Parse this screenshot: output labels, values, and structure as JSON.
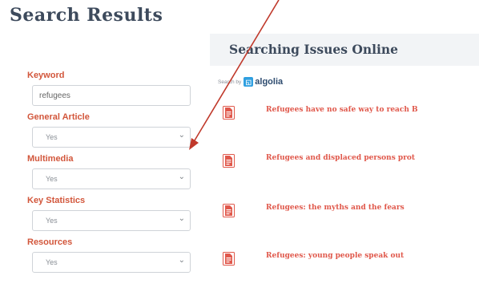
{
  "page": {
    "title": "Search Results"
  },
  "filters": {
    "keyword": {
      "label": "Keyword",
      "value": "refugees"
    },
    "selects": [
      {
        "label": "General Article",
        "value": "Yes"
      },
      {
        "label": "Multimedia",
        "value": "Yes"
      },
      {
        "label": "Key Statistics",
        "value": "Yes"
      },
      {
        "label": "Resources",
        "value": "Yes"
      }
    ]
  },
  "results": {
    "title": "Searching Issues Online",
    "search_by": "Search by",
    "provider": "algolia",
    "items": [
      {
        "title": "Refugees have no safe way to reach B"
      },
      {
        "title": "Refugees and displaced persons prot"
      },
      {
        "title": "Refugees: the myths and the fears"
      },
      {
        "title": "Refugees: young people speak out"
      }
    ]
  },
  "colors": {
    "label": "#d2563b",
    "result_title": "#e0584b",
    "heading": "#3d4a5c",
    "algolia": "#2f9fe0",
    "arrow": "#c0392b"
  },
  "icons": [
    "document-icon",
    "chevron-down-icon"
  ]
}
